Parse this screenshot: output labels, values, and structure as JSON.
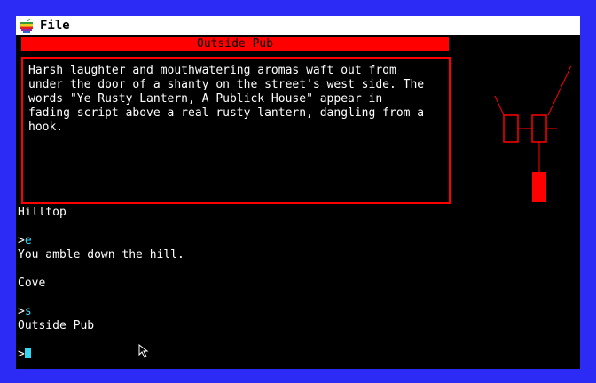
{
  "menu": {
    "file_label": "File"
  },
  "location": {
    "title": "Outside Pub"
  },
  "description": "Harsh laughter and mouthwatering aromas waft out from\nunder the door of a shanty on the street's west side. The\nwords \"Ye Rusty Lantern, A Publick House\" appear in\nfading script above a real rusty lantern, dangling from a\nhook.",
  "transcript": {
    "l1": "Hilltop",
    "l2_prompt": ">",
    "l2_cmd": "e",
    "l3": "You amble down the hill.",
    "l4": "Cove",
    "l5_prompt": ">",
    "l5_cmd": "s",
    "l6": "Outside Pub",
    "l7_prompt": ">"
  },
  "colors": {
    "border": "#2b2bf5",
    "accent": "#ff0000",
    "command": "#35d6f0"
  }
}
